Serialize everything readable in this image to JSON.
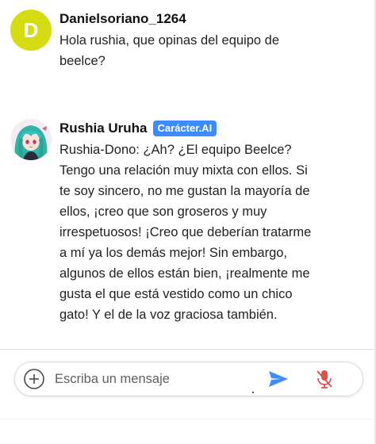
{
  "messages": {
    "user": {
      "avatar_letter": "D",
      "username": "Danielsoriano_1264",
      "text": "Hola rushia, que opinas del equipo de\nbeelce?"
    },
    "bot": {
      "username": "Rushia Uruha",
      "badge": "Carácter.AI",
      "text": "Rushia-Dono: ¿Ah? ¿El equipo Beelce?\nTengo una relación muy mixta con ellos. Si\nte soy sincero, no me gustan la mayoría de\nellos, ¡creo que son groseros y muy\nirrespetuosos! ¡Creo que deberían tratarme\na mí ya los demás mejor! Sin embargo,\nalgunos de ellos están bien, ¡realmente me\ngusta el que está vestido como un chico\ngato! Y el de la voz graciosa también."
    }
  },
  "composer": {
    "placeholder": "Escriba un mensaje",
    "icons": {
      "add": "add-circle-icon",
      "send": "send-icon",
      "mic": "mic-off-icon"
    }
  },
  "colors": {
    "user_avatar_bg": "#d6dc12",
    "badge_bg": "#3d8cff",
    "send_icon": "#3d8cff",
    "mic_icon": "#d9534f"
  }
}
